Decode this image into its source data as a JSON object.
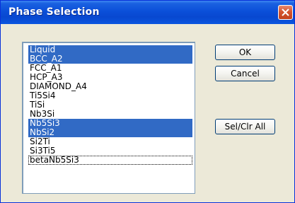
{
  "window": {
    "title": "Phase Selection"
  },
  "phase_list": {
    "items": [
      {
        "label": "Liquid",
        "selected": true
      },
      {
        "label": "BCC_A2",
        "selected": true
      },
      {
        "label": "FCC_A1",
        "selected": false
      },
      {
        "label": "HCP_A3",
        "selected": false
      },
      {
        "label": "DIAMOND_A4",
        "selected": false
      },
      {
        "label": "Ti5Si4",
        "selected": false
      },
      {
        "label": "TiSi",
        "selected": false
      },
      {
        "label": "Nb3Si",
        "selected": false
      },
      {
        "label": "Nb5Si3",
        "selected": true
      },
      {
        "label": "NbSi2",
        "selected": true
      },
      {
        "label": "Si2Ti",
        "selected": false
      },
      {
        "label": "Si3Ti5",
        "selected": false
      },
      {
        "label": "betaNb5Si3",
        "selected": false,
        "focused": true
      }
    ]
  },
  "buttons": {
    "ok_label": "OK",
    "cancel_label": "Cancel",
    "sel_clr_all_label": "Sel/Clr All"
  },
  "colors": {
    "selection": "#316ac5",
    "titlebar": "#0848d0",
    "dialog_background": "#ece9d8"
  }
}
